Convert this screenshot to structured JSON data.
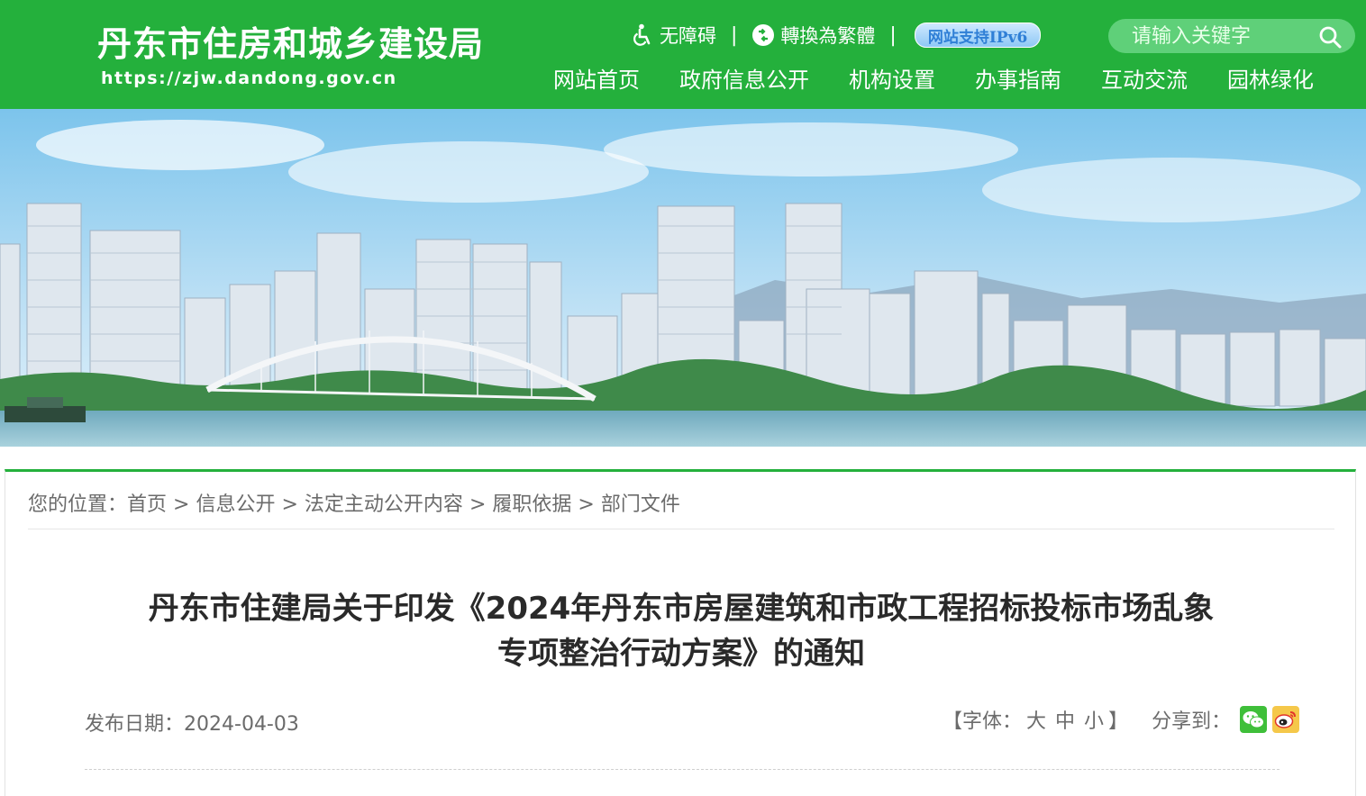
{
  "header": {
    "site_name": "丹东市住房和城乡建设局",
    "site_url": "https://zjw.dandong.gov.cn",
    "tools": {
      "accessibility": "无障碍",
      "traditional": "轉換為繁體",
      "ipv6": "网站支持IPv6"
    },
    "search": {
      "placeholder": "请输入关键字"
    },
    "nav": [
      "网站首页",
      "政府信息公开",
      "机构设置",
      "办事指南",
      "互动交流",
      "园林绿化"
    ],
    "color": "#24b03c"
  },
  "breadcrumb": {
    "prefix": "您的位置：",
    "items": [
      "首页",
      "信息公开",
      "法定主动公开内容",
      "履职依据",
      "部门文件"
    ],
    "separator": ">"
  },
  "article": {
    "title_line1": "丹东市住建局关于印发《2024年丹东市房屋建筑和市政工程招标投标市场乱象",
    "title_line2": "专项整治行动方案》的通知",
    "date_label": "发布日期：",
    "date": "2024-04-03",
    "font_open": "【字体：",
    "font_large": "大",
    "font_medium": "中",
    "font_small": "小",
    "font_close": "】",
    "share_label": "分享到："
  },
  "icons": {
    "accessibility": "wheelchair-icon",
    "traditional": "convert-icon",
    "search": "search-icon",
    "wechat": "wechat-icon",
    "weibo": "weibo-icon"
  }
}
